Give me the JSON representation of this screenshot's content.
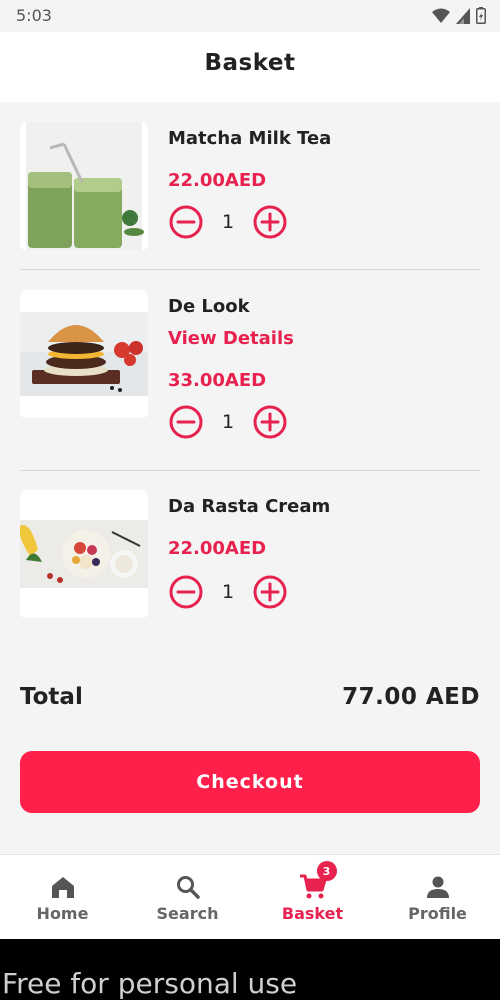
{
  "status_bar": {
    "time": "5:03"
  },
  "header": {
    "title": "Basket"
  },
  "items": [
    {
      "name": "Matcha Milk Tea",
      "link": "",
      "price": "22.00AED",
      "quantity": "1",
      "image": "matcha-milk-tea-image"
    },
    {
      "name": "De Look",
      "link": "View Details",
      "price": "33.00AED",
      "quantity": "1",
      "image": "burger-image"
    },
    {
      "name": "Da Rasta Cream",
      "link": "",
      "price": "22.00AED",
      "quantity": "1",
      "image": "acai-bowl-image"
    }
  ],
  "total": {
    "label": "Total",
    "value": "77.00 AED"
  },
  "checkout": {
    "label": "Checkout"
  },
  "nav": {
    "items": [
      {
        "label": "Home",
        "icon": "home-icon",
        "active": false
      },
      {
        "label": "Search",
        "icon": "search-icon",
        "active": false
      },
      {
        "label": "Basket",
        "icon": "cart-icon",
        "active": true,
        "badge": "3"
      },
      {
        "label": "Profile",
        "icon": "person-icon",
        "active": false
      }
    ]
  },
  "watermark": {
    "text": "Free for personal use"
  },
  "colors": {
    "accent": "#e8224f",
    "checkout_bg": "#ff1f4b",
    "text": "#222222"
  }
}
